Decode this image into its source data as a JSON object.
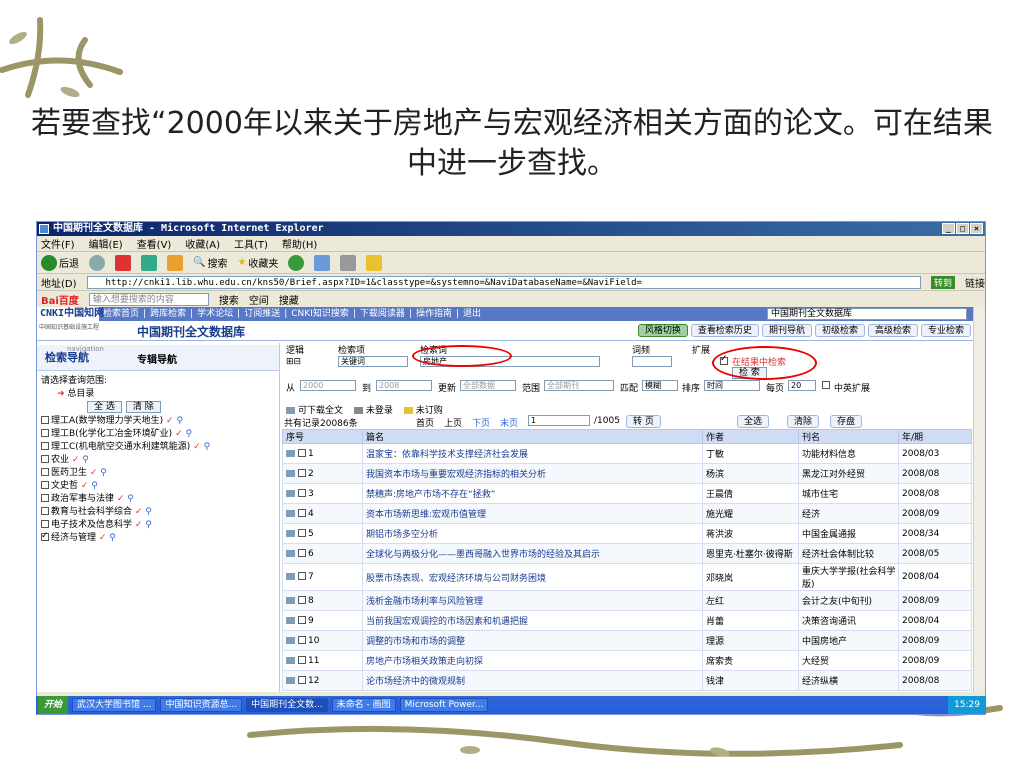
{
  "slide": {
    "title": "若要查找“2000年以来关于房地产与宏观经济相关方面的论文。可在结果中进一步查找。"
  },
  "window": {
    "title": "中国期刊全文数据库 - Microsoft Internet Explorer",
    "menu": [
      "文件(F)",
      "编辑(E)",
      "查看(V)",
      "收藏(A)",
      "工具(T)",
      "帮助(H)"
    ],
    "toolbar": {
      "back": "后退",
      "search": "搜索",
      "favorites": "收藏夹"
    },
    "address_label": "地址(D)",
    "address": "http://cnki1.lib.whu.edu.cn/kns50/Brief.aspx?ID=1&classtype=&systemno=&NaviDatabaseName=&NaviField=",
    "go": "转到",
    "links": "链接",
    "baidu": {
      "logo": "Bai百度",
      "placeholder": "输入想要搜索的内容",
      "search": "搜索",
      "space": "空间",
      "favorites": "搜藏"
    }
  },
  "cnki": {
    "logo": "CNKI中国知网",
    "subtitle": "中国知识基础设施工程",
    "site_title": "中国期刊全文数据库",
    "nav": [
      "检索首页",
      "跨库检索",
      "学术论坛",
      "订阅推送",
      "CNKI知识搜索",
      "下载阅读器",
      "操作指南",
      "退出"
    ],
    "db_selected": "中国期刊全文数据库",
    "tabs": [
      "风格切换",
      "查看检索历史",
      "期刊导航",
      "初级检索",
      "高级检索",
      "专业检索"
    ]
  },
  "left": {
    "nav_title": "检索导航",
    "nav_en": "navigation",
    "nav_sub": "专辑导航",
    "range_label": "请选择查询范围:",
    "catalog": "总目录",
    "select_all": "全 选",
    "clear": "清 除",
    "categories": [
      {
        "label": "理工A(数学物理力学天地生)",
        "checked": false
      },
      {
        "label": "理工B(化学化工冶金环境矿业)",
        "checked": false
      },
      {
        "label": "理工C(机电航空交通水利建筑能源)",
        "checked": false
      },
      {
        "label": "农业",
        "checked": false
      },
      {
        "label": "医药卫生",
        "checked": false
      },
      {
        "label": "文史哲",
        "checked": false
      },
      {
        "label": "政治军事与法律",
        "checked": false
      },
      {
        "label": "教育与社会科学综合",
        "checked": false
      },
      {
        "label": "电子技术及信息科学",
        "checked": false
      },
      {
        "label": "经济与管理",
        "checked": true
      }
    ]
  },
  "form": {
    "logic": "逻辑",
    "field_label": "检索项",
    "term_label": "检索词",
    "freq_label": "词频",
    "expand_label": "扩展",
    "field_value": "关键词",
    "term_value": "房地产",
    "in_results": "在结果中检索",
    "search_btn": "检 索",
    "from": "从",
    "year_from": "2000",
    "to": "到",
    "year_to": "2008",
    "update": "更新",
    "update_value": "全部数据",
    "scope": "范围",
    "scope_value": "全部期刊",
    "match": "匹配",
    "match_value": "模糊",
    "sort": "排序",
    "sort_value": "时间",
    "per_page": "每页",
    "per_page_value": "20",
    "cn_en": "中英扩展"
  },
  "legend": {
    "download": "可下载全文",
    "not_logged": "未登录",
    "not_ordered": "未订购"
  },
  "results": {
    "summary": "共有记录20086条",
    "first": "首页",
    "prev": "上页",
    "next": "下页",
    "last": "末页",
    "page": "1",
    "total_pages": "/1005",
    "goto": "转 页",
    "select_all": "全选",
    "clear": "清除",
    "save": "存盘",
    "headers": [
      "序号",
      "篇名",
      "作者",
      "刊名",
      "年/期"
    ],
    "rows": [
      {
        "no": "1",
        "title": "温家宝：依靠科学技术支撑经济社会发展",
        "author": "丁敏",
        "journal": "功能材料信息",
        "issue": "2008/03"
      },
      {
        "no": "2",
        "title": "我国资本市场与重要宏观经济指标的相关分析",
        "author": "杨滨",
        "journal": "黑龙江对外经贸",
        "issue": "2008/08"
      },
      {
        "no": "3",
        "title": "禁穗声:房地产市场不存在“拯救”",
        "author": "王晨倩",
        "journal": "城市住宅",
        "issue": "2008/08"
      },
      {
        "no": "4",
        "title": "资本市场新思维:宏观市值管理",
        "author": "施光耀",
        "journal": "经济",
        "issue": "2008/09"
      },
      {
        "no": "5",
        "title": "期铝市场多空分析",
        "author": "蒋洪波",
        "journal": "中国金属通报",
        "issue": "2008/34"
      },
      {
        "no": "6",
        "title": "全球化与两极分化——墨西哥融入世界市场的经验及其启示",
        "author": "恩里克·杜塞尔·彼得斯",
        "journal": "经济社会体制比较",
        "issue": "2008/05"
      },
      {
        "no": "7",
        "title": "股票市场表现、宏观经济环境与公司财务困境",
        "author": "邓晓岚",
        "journal": "重庆大学学报(社会科学版)",
        "issue": "2008/04"
      },
      {
        "no": "8",
        "title": "浅析金融市场利率与风险管理",
        "author": "左红",
        "journal": "会计之友(中旬刊)",
        "issue": "2008/09"
      },
      {
        "no": "9",
        "title": "当前我国宏观调控的市场因素和机遇把握",
        "author": "肖蕾",
        "journal": "决策咨询通讯",
        "issue": "2008/04"
      },
      {
        "no": "10",
        "title": "调整的市场和市场的调整",
        "author": "理源",
        "journal": "中国房地产",
        "issue": "2008/09"
      },
      {
        "no": "11",
        "title": "房地产市场相关政策走向初探",
        "author": "席索贵",
        "journal": "大经贸",
        "issue": "2008/09"
      },
      {
        "no": "12",
        "title": "论市场经济中的微观规制",
        "author": "钱津",
        "journal": "经济纵横",
        "issue": "2008/08"
      }
    ]
  },
  "taskbar": {
    "start": "开始",
    "tasks": [
      "武汉大学图书馆 ...",
      "中国知识资源总...",
      "中国期刊全文数...",
      "未命名 - 画图",
      "Microsoft Power..."
    ],
    "clock": "15:29"
  }
}
